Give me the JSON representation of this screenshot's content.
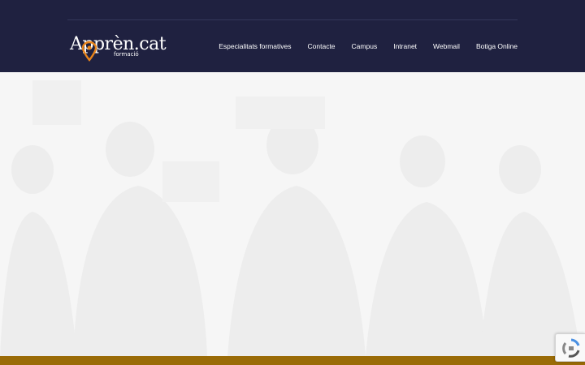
{
  "brand": {
    "logo_text": "Apprèn.cat",
    "logo_subtext": "formació",
    "header_bg": "#1f2140",
    "accent": "#e8841a",
    "footer_bar": "#9a6b07"
  },
  "nav": {
    "items": [
      {
        "label": "Especialitats formatives"
      },
      {
        "label": "Contacte"
      },
      {
        "label": "Campus"
      },
      {
        "label": "Intranet"
      },
      {
        "label": "Webmail"
      },
      {
        "label": "Botiga Online"
      }
    ]
  },
  "hero": {
    "image": "faded-photo-of-people"
  },
  "widgets": {
    "recaptcha_icon": "recaptcha-icon"
  }
}
